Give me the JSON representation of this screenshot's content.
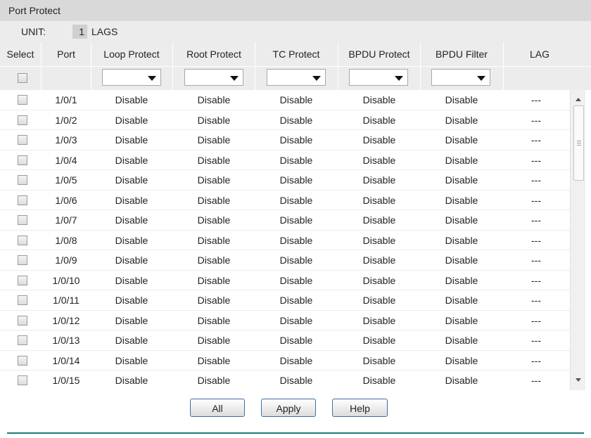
{
  "panel": {
    "title": "Port Protect"
  },
  "unit": {
    "label": "UNIT:",
    "number": "1",
    "lags": "LAGS"
  },
  "columns": [
    "Select",
    "Port",
    "Loop Protect",
    "Root Protect",
    "TC Protect",
    "BPDU Protect",
    "BPDU Filter",
    "LAG"
  ],
  "filters": {
    "loop": "",
    "root": "",
    "tc": "",
    "bpdu_protect": "",
    "bpdu_filter": ""
  },
  "rows": [
    {
      "port": "1/0/1",
      "loop": "Disable",
      "root": "Disable",
      "tc": "Disable",
      "bpdu_protect": "Disable",
      "bpdu_filter": "Disable",
      "lag": "---"
    },
    {
      "port": "1/0/2",
      "loop": "Disable",
      "root": "Disable",
      "tc": "Disable",
      "bpdu_protect": "Disable",
      "bpdu_filter": "Disable",
      "lag": "---"
    },
    {
      "port": "1/0/3",
      "loop": "Disable",
      "root": "Disable",
      "tc": "Disable",
      "bpdu_protect": "Disable",
      "bpdu_filter": "Disable",
      "lag": "---"
    },
    {
      "port": "1/0/4",
      "loop": "Disable",
      "root": "Disable",
      "tc": "Disable",
      "bpdu_protect": "Disable",
      "bpdu_filter": "Disable",
      "lag": "---"
    },
    {
      "port": "1/0/5",
      "loop": "Disable",
      "root": "Disable",
      "tc": "Disable",
      "bpdu_protect": "Disable",
      "bpdu_filter": "Disable",
      "lag": "---"
    },
    {
      "port": "1/0/6",
      "loop": "Disable",
      "root": "Disable",
      "tc": "Disable",
      "bpdu_protect": "Disable",
      "bpdu_filter": "Disable",
      "lag": "---"
    },
    {
      "port": "1/0/7",
      "loop": "Disable",
      "root": "Disable",
      "tc": "Disable",
      "bpdu_protect": "Disable",
      "bpdu_filter": "Disable",
      "lag": "---"
    },
    {
      "port": "1/0/8",
      "loop": "Disable",
      "root": "Disable",
      "tc": "Disable",
      "bpdu_protect": "Disable",
      "bpdu_filter": "Disable",
      "lag": "---"
    },
    {
      "port": "1/0/9",
      "loop": "Disable",
      "root": "Disable",
      "tc": "Disable",
      "bpdu_protect": "Disable",
      "bpdu_filter": "Disable",
      "lag": "---"
    },
    {
      "port": "1/0/10",
      "loop": "Disable",
      "root": "Disable",
      "tc": "Disable",
      "bpdu_protect": "Disable",
      "bpdu_filter": "Disable",
      "lag": "---"
    },
    {
      "port": "1/0/11",
      "loop": "Disable",
      "root": "Disable",
      "tc": "Disable",
      "bpdu_protect": "Disable",
      "bpdu_filter": "Disable",
      "lag": "---"
    },
    {
      "port": "1/0/12",
      "loop": "Disable",
      "root": "Disable",
      "tc": "Disable",
      "bpdu_protect": "Disable",
      "bpdu_filter": "Disable",
      "lag": "---"
    },
    {
      "port": "1/0/13",
      "loop": "Disable",
      "root": "Disable",
      "tc": "Disable",
      "bpdu_protect": "Disable",
      "bpdu_filter": "Disable",
      "lag": "---"
    },
    {
      "port": "1/0/14",
      "loop": "Disable",
      "root": "Disable",
      "tc": "Disable",
      "bpdu_protect": "Disable",
      "bpdu_filter": "Disable",
      "lag": "---"
    },
    {
      "port": "1/0/15",
      "loop": "Disable",
      "root": "Disable",
      "tc": "Disable",
      "bpdu_protect": "Disable",
      "bpdu_filter": "Disable",
      "lag": "---"
    }
  ],
  "buttons": {
    "all": "All",
    "apply": "Apply",
    "help": "Help"
  },
  "colors": {
    "accent_border": "#3c6fa8",
    "footer_line": "#1c7a7a",
    "header_bg": "#ececec",
    "title_bg": "#d9d9d9"
  }
}
